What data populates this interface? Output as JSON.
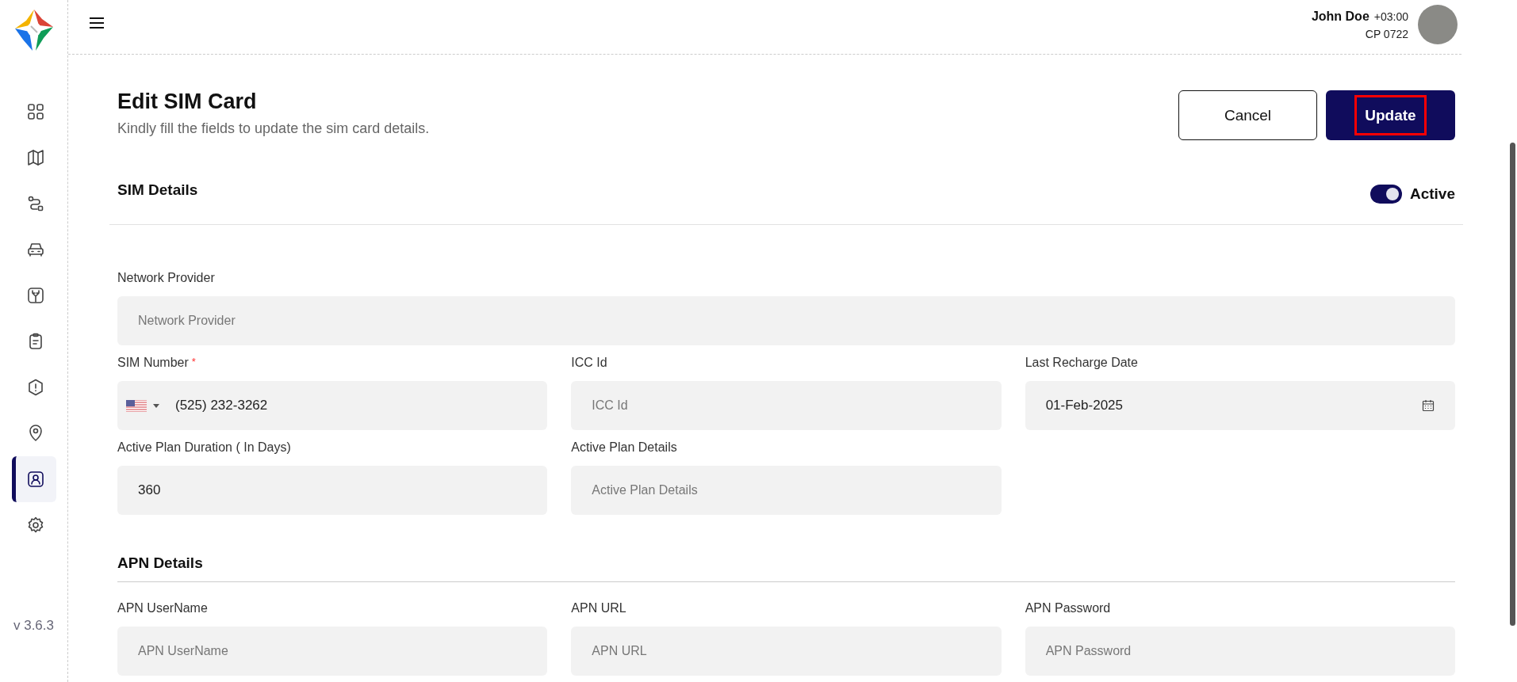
{
  "sidebar": {
    "items": [
      {
        "kind": "grid",
        "selected": false
      },
      {
        "kind": "map",
        "selected": false
      },
      {
        "kind": "route",
        "selected": false
      },
      {
        "kind": "car",
        "selected": false
      },
      {
        "kind": "fork",
        "selected": false
      },
      {
        "kind": "clipboard",
        "selected": false
      },
      {
        "kind": "alert",
        "selected": false
      },
      {
        "kind": "pin",
        "selected": false
      },
      {
        "kind": "user",
        "selected": true
      },
      {
        "kind": "gear",
        "selected": false
      }
    ],
    "version": "v 3.6.3"
  },
  "header": {
    "user_name": "John Doe",
    "timezone": "+03:00",
    "code": "CP 0722"
  },
  "page": {
    "title": "Edit SIM Card",
    "subtitle": "Kindly fill the fields to update the sim card details."
  },
  "buttons": [
    {
      "label": "Cancel",
      "kind": "secondary",
      "highlighted": false
    },
    {
      "label": "Update",
      "kind": "primary",
      "highlighted": true
    }
  ],
  "sim_details": {
    "title": "SIM Details",
    "active_toggle": {
      "label": "Active",
      "on": true
    },
    "fields": [
      {
        "kind": "wide",
        "label": "Network Provider",
        "placeholder": "Network Provider"
      },
      {
        "kind": "phone",
        "label": "SIM Number",
        "required_mark": "*",
        "value": "(525) 232-3262"
      },
      {
        "kind": "text",
        "label": "ICC Id",
        "placeholder": "ICC Id"
      },
      {
        "kind": "date",
        "label": "Last Recharge Date",
        "value": "01-Feb-2025"
      },
      {
        "kind": "text",
        "label": "Active Plan Duration ( In Days)",
        "value": "360"
      },
      {
        "kind": "text",
        "label": "Active Plan Details",
        "placeholder": "Active Plan Details"
      }
    ]
  },
  "apn_details": {
    "title": "APN Details",
    "fields": [
      {
        "label": "APN UserName",
        "placeholder": "APN UserName"
      },
      {
        "label": "APN URL",
        "placeholder": "APN URL"
      },
      {
        "label": "APN Password",
        "placeholder": "APN Password"
      }
    ]
  }
}
